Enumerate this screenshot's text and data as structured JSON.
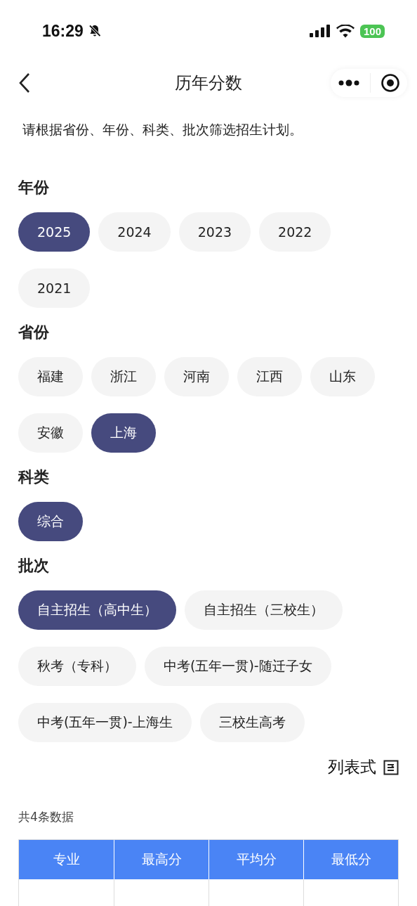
{
  "status_bar": {
    "time": "16:29",
    "battery": "100"
  },
  "nav": {
    "title": "历年分数"
  },
  "intro": "请根据省份、年份、科类、批次筛选招生计划。",
  "filters": [
    {
      "label": "年份",
      "options": [
        {
          "text": "2025",
          "selected": true
        },
        {
          "text": "2024",
          "selected": false
        },
        {
          "text": "2023",
          "selected": false
        },
        {
          "text": "2022",
          "selected": false
        },
        {
          "text": "2021",
          "selected": false
        }
      ]
    },
    {
      "label": "省份",
      "options": [
        {
          "text": "福建",
          "selected": false
        },
        {
          "text": "浙江",
          "selected": false
        },
        {
          "text": "河南",
          "selected": false
        },
        {
          "text": "江西",
          "selected": false
        },
        {
          "text": "山东",
          "selected": false
        },
        {
          "text": "安徽",
          "selected": false
        },
        {
          "text": "上海",
          "selected": true
        }
      ]
    },
    {
      "label": "科类",
      "options": [
        {
          "text": "综合",
          "selected": true
        }
      ]
    },
    {
      "label": "批次",
      "options": [
        {
          "text": "自主招生（高中生）",
          "selected": true
        },
        {
          "text": "自主招生（三校生）",
          "selected": false
        },
        {
          "text": "秋考（专科）",
          "selected": false
        },
        {
          "text": "中考(五年一贯)-随迁子女",
          "selected": false
        },
        {
          "text": "中考(五年一贯)-上海生",
          "selected": false
        },
        {
          "text": "三校生高考",
          "selected": false
        }
      ]
    }
  ],
  "view_toggle": "列表式",
  "count": "共4条数据",
  "table": {
    "columns": [
      "专业",
      "最高分",
      "平均分",
      "最低分"
    ]
  }
}
